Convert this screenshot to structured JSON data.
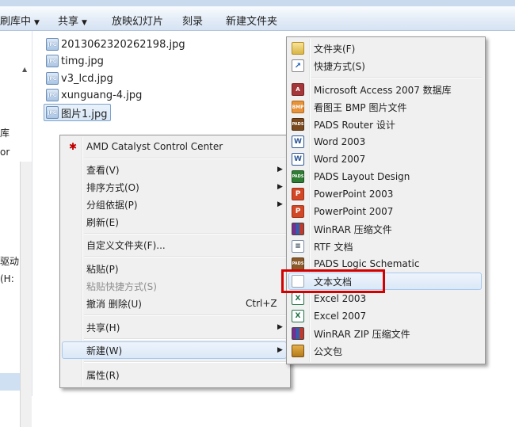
{
  "toolbar": {
    "organize": "刷库中",
    "share": "共享",
    "slideshow": "放映幻灯片",
    "burn": "刻录",
    "new_folder": "新建文件夹"
  },
  "nav": {
    "items": [
      "库",
      "or",
      "驱动",
      "(H:"
    ]
  },
  "files": [
    {
      "name": "2013062320262198.jpg",
      "icon": "jpg-file-icon"
    },
    {
      "name": "timg.jpg",
      "icon": "jpg-file-icon"
    },
    {
      "name": "v3_lcd.jpg",
      "icon": "jpg-file-icon"
    },
    {
      "name": "xunguang-4.jpg",
      "icon": "jpg-file-icon"
    },
    {
      "name": "图片1.jpg",
      "icon": "jpg-file-icon",
      "selected": true
    }
  ],
  "context_menu": {
    "header": "AMD Catalyst Control Center",
    "items": {
      "view": "查看(V)",
      "sort": "排序方式(O)",
      "group": "分组依据(P)",
      "refresh": "刷新(E)",
      "customize": "自定义文件夹(F)...",
      "paste": "粘贴(P)",
      "paste_shortcut": "粘贴快捷方式(S)",
      "undo": "撤消 删除(U)",
      "undo_shortcut": "Ctrl+Z",
      "share": "共享(H)",
      "new": "新建(W)",
      "properties": "属性(R)"
    }
  },
  "new_submenu": {
    "items": [
      {
        "label": "文件夹(F)",
        "icon": "folder-icon"
      },
      {
        "label": "快捷方式(S)",
        "icon": "shortcut-icon"
      },
      {
        "label": "Microsoft Access 2007 数据库",
        "icon": "access-icon"
      },
      {
        "label": "看图王 BMP 图片文件",
        "icon": "bmp-icon"
      },
      {
        "label": "PADS Router 设计",
        "icon": "pads-router-icon"
      },
      {
        "label": "Word 2003",
        "icon": "word-icon"
      },
      {
        "label": "Word 2007",
        "icon": "word-icon"
      },
      {
        "label": "PADS Layout Design",
        "icon": "pads-layout-icon"
      },
      {
        "label": "PowerPoint 2003",
        "icon": "powerpoint-icon"
      },
      {
        "label": "PowerPoint 2007",
        "icon": "powerpoint-icon"
      },
      {
        "label": "WinRAR 压缩文件",
        "icon": "winrar-icon"
      },
      {
        "label": "RTF 文档",
        "icon": "rtf-icon"
      },
      {
        "label": "PADS Logic Schematic",
        "icon": "pads-logic-icon"
      },
      {
        "label": "文本文档",
        "icon": "text-document-icon"
      },
      {
        "label": "Excel 2003",
        "icon": "excel-icon"
      },
      {
        "label": "Excel 2007",
        "icon": "excel-icon"
      },
      {
        "label": "WinRAR ZIP 压缩文件",
        "icon": "winrar-zip-icon"
      },
      {
        "label": "公文包",
        "icon": "briefcase-icon"
      }
    ]
  },
  "colors": {
    "highlight_border": "#d40000",
    "menu_bg": "#f0f0f0",
    "toolbar_bg": "#dce7f4"
  }
}
